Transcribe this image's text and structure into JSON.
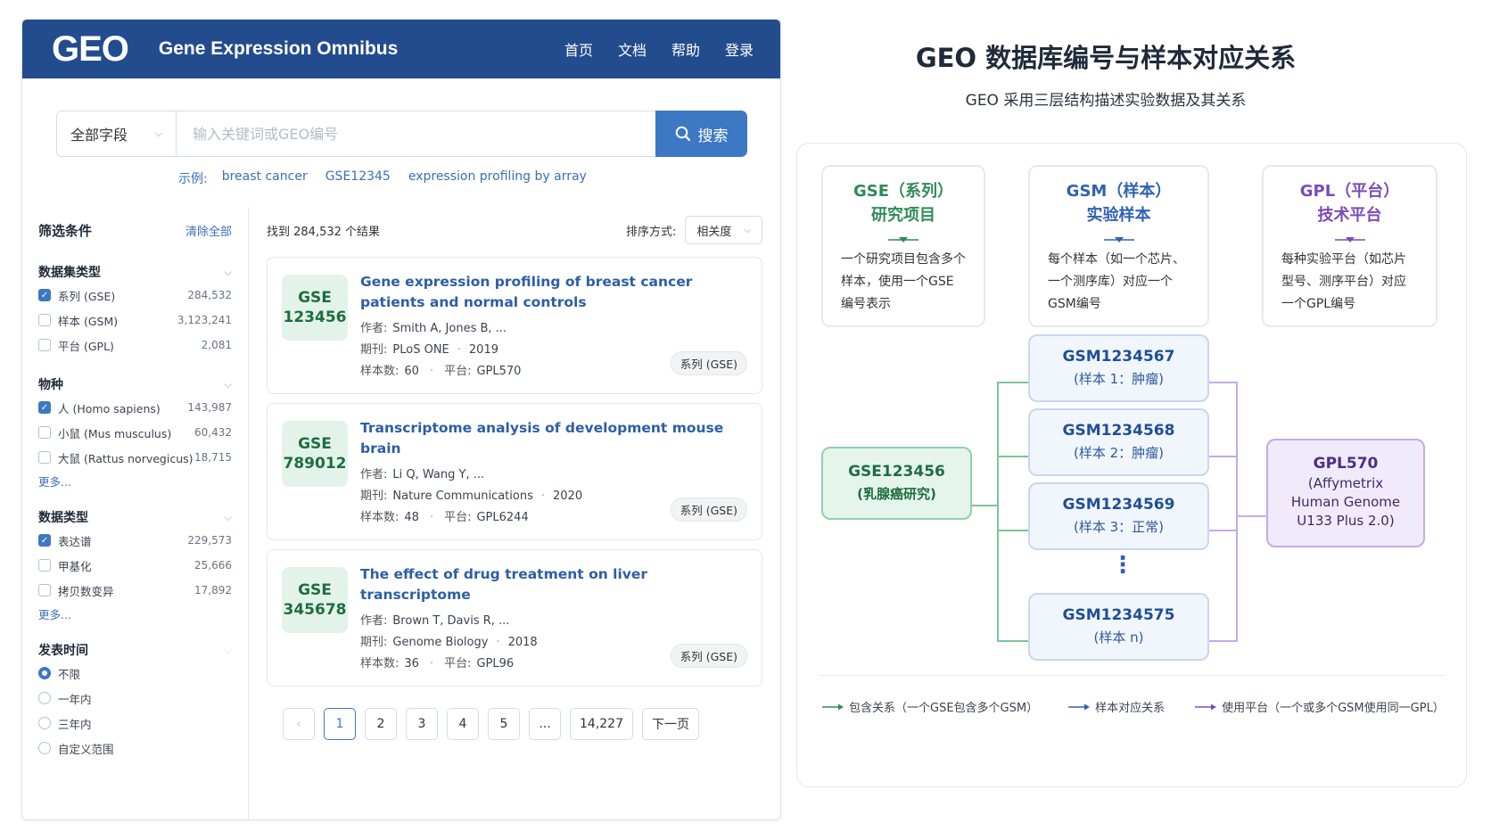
{
  "header": {
    "logo": "GEO",
    "title": "Gene Expression Omnibus",
    "nav": [
      "首页",
      "文档",
      "帮助",
      "登录"
    ]
  },
  "search": {
    "field": "全部字段",
    "placeholder": "输入关键词或GEO编号",
    "button": "搜索",
    "examples_label": "示例:",
    "examples": [
      "breast cancer",
      "GSE12345",
      "expression profiling by array"
    ]
  },
  "sidebar": {
    "title": "筛选条件",
    "clear": "清除全部",
    "groups": [
      {
        "title": "数据集类型",
        "options": [
          {
            "label": "系列 (GSE)",
            "count": "284,532",
            "checked": true
          },
          {
            "label": "样本 (GSM)",
            "count": "3,123,241",
            "checked": false
          },
          {
            "label": "平台 (GPL)",
            "count": "2,081",
            "checked": false
          }
        ]
      },
      {
        "title": "物种",
        "options": [
          {
            "label": "人 (Homo sapiens)",
            "count": "143,987",
            "checked": true
          },
          {
            "label": "小鼠 (Mus musculus)",
            "count": "60,432",
            "checked": false
          },
          {
            "label": "大鼠 (Rattus norvegicus)",
            "count": "18,715",
            "checked": false
          }
        ],
        "more": "更多..."
      },
      {
        "title": "数据类型",
        "options": [
          {
            "label": "表达谱",
            "count": "229,573",
            "checked": true
          },
          {
            "label": "甲基化",
            "count": "25,666",
            "checked": false
          },
          {
            "label": "拷贝数变异",
            "count": "17,892",
            "checked": false
          }
        ],
        "more": "更多..."
      },
      {
        "title": "发表时间",
        "options": [
          {
            "label": "不限",
            "checked": true
          },
          {
            "label": "一年内",
            "checked": false
          },
          {
            "label": "三年内",
            "checked": false
          },
          {
            "label": "自定义范围",
            "checked": false
          }
        ]
      }
    ]
  },
  "results": {
    "count_text": "找到 284,532 个结果",
    "sort_label": "排序方式:",
    "sort_value": "相关度",
    "labels": {
      "author": "作者:",
      "journal": "期刊:",
      "samples": "样本数:",
      "platform": "平台:"
    },
    "items": [
      {
        "acc_prefix": "GSE",
        "acc_num": "123456",
        "title": "Gene expression profiling of breast cancer patients and normal controls",
        "authors": "Smith A, Jones B, ...",
        "journal": "PLoS ONE",
        "year": "2019",
        "samples": "60",
        "platform": "GPL570",
        "tag": "系列 (GSE)"
      },
      {
        "acc_prefix": "GSE",
        "acc_num": "789012",
        "title": "Transcriptome analysis of development mouse brain",
        "authors": "Li Q, Wang Y, ...",
        "journal": "Nature Communications",
        "year": "2020",
        "samples": "48",
        "platform": "GPL6244",
        "tag": "系列 (GSE)"
      },
      {
        "acc_prefix": "GSE",
        "acc_num": "345678",
        "title": "The effect of drug treatment on liver transcriptome",
        "authors": "Brown T, Davis R, ...",
        "journal": "Genome Biology",
        "year": "2018",
        "samples": "36",
        "platform": "GPL96",
        "tag": "系列 (GSE)"
      }
    ],
    "pager": {
      "prev": "‹",
      "pages": [
        "1",
        "2",
        "3",
        "4",
        "5"
      ],
      "ellipsis": "...",
      "last": "14,227",
      "next": "下一页",
      "current": "1"
    }
  },
  "panel": {
    "title": "GEO 数据库编号与样本对应关系",
    "subtitle": "GEO 采用三层结构描述实验数据及其关系",
    "defs": [
      {
        "h1": "GSE（系列）",
        "h2": "研究项目",
        "desc": "一个研究项目包含多个样本，使用一个GSE编号表示",
        "color": "#2e8b57"
      },
      {
        "h1": "GSM（样本）",
        "h2": "实验样本",
        "desc": "每个样本（如一个芯片、一个测序库）对应一个GSM编号",
        "color": "#2f63b0"
      },
      {
        "h1": "GPL（平台）",
        "h2": "技术平台",
        "desc": "每种实验平台（如芯片型号、测序平台）对应一个GPL编号",
        "color": "#7b4bb8"
      }
    ],
    "gse": {
      "id": "GSE123456",
      "desc": "(乳腺癌研究)"
    },
    "gsms": [
      {
        "id": "GSM1234567",
        "desc": "(样本 1：肿瘤)"
      },
      {
        "id": "GSM1234568",
        "desc": "(样本 2：肿瘤)"
      },
      {
        "id": "GSM1234569",
        "desc": "(样本 3：正常)"
      },
      {
        "id": "GSM1234575",
        "desc": "(样本 n)"
      }
    ],
    "gsm_dots": "⋮",
    "gpl": {
      "id": "GPL570",
      "line1": "(Affymetrix",
      "line2": "Human Genome",
      "line3": "U133 Plus 2.0)"
    },
    "legend": [
      "包含关系（一个GSE包含多个GSM）",
      "样本对应关系",
      "使用平台（一个或多个GSM使用同一GPL）"
    ],
    "colors": {
      "green": "#2e8b57",
      "blue": "#2f63b0",
      "purple": "#7b4bb8"
    }
  }
}
